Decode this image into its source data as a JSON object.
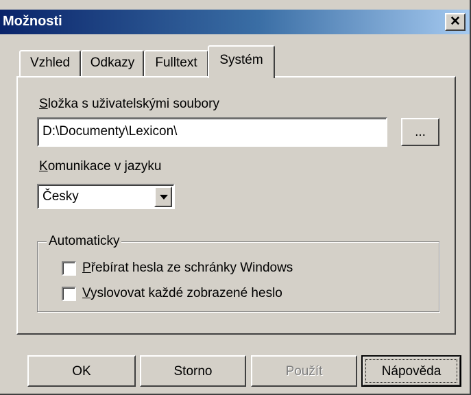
{
  "window": {
    "title": "Možnosti",
    "close_symbol": "✕"
  },
  "tabs": [
    {
      "label": "Vzhled",
      "active": false
    },
    {
      "label": "Odkazy",
      "active": false
    },
    {
      "label": "Fulltext",
      "active": false
    },
    {
      "label": "Systém",
      "active": true
    }
  ],
  "system": {
    "folder_label_key": "S",
    "folder_label_rest": "ložka s uživatelskými soubory",
    "folder_value": "D:\\Documenty\\Lexicon\\",
    "browse_label": "...",
    "language_label_key": "K",
    "language_label_rest": "omunikace v jazyku",
    "language_value": "Česky",
    "group_label": "Automaticky",
    "checkbox1_key": "P",
    "checkbox1_rest": "řebírat hesla ze schránky Windows",
    "checkbox1_checked": false,
    "checkbox2_key": "V",
    "checkbox2_rest": "yslovovat každé zobrazené heslo",
    "checkbox2_checked": false
  },
  "buttons": {
    "ok": "OK",
    "cancel": "Storno",
    "apply": "Použít",
    "help": "Nápověda"
  },
  "colors": {
    "dialog_bg": "#d4d0c8",
    "title_gradient_start": "#0a246a",
    "title_gradient_end": "#a6caf0",
    "disabled_text": "#808080"
  },
  "icons": {
    "close": "close-icon",
    "dropdown": "chevron-down-icon"
  }
}
